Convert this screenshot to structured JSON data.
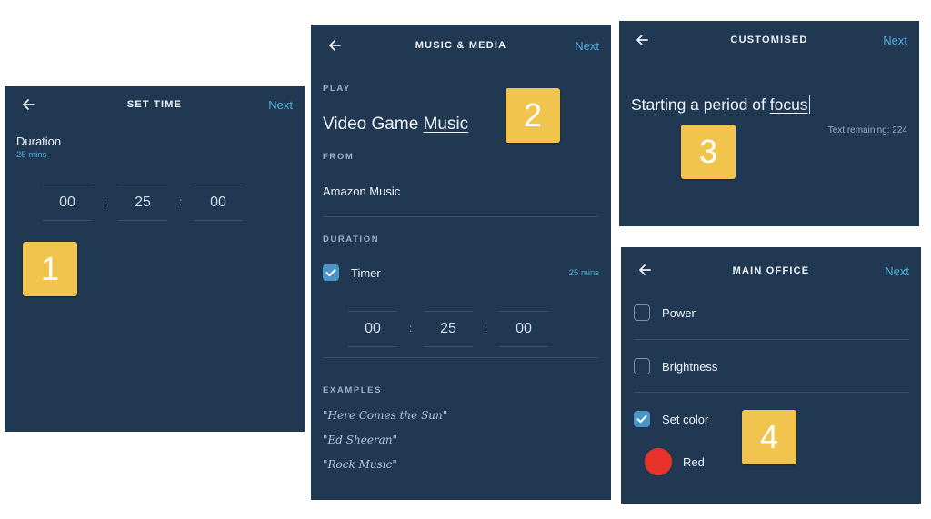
{
  "colors": {
    "panel_bg": "#213853",
    "accent": "#4fb0dc",
    "badge": "#f0c44d",
    "checkbox_on": "#4a95c8",
    "red_swatch": "#e8332a"
  },
  "panel1": {
    "badge": "1",
    "back_icon": "arrow-left-icon",
    "title": "SET TIME",
    "next": "Next",
    "duration_label": "Duration",
    "duration_value": "25 mins",
    "time": {
      "hours": "00",
      "minutes": "25",
      "seconds": "00",
      "separator": ":"
    }
  },
  "panel2": {
    "badge": "2",
    "back_icon": "arrow-left-icon",
    "title": "MUSIC & MEDIA",
    "next": "Next",
    "play_label": "PLAY",
    "play_prefix": "Video Game ",
    "play_keyword": "Music",
    "from_label": "FROM",
    "from_value": "Amazon Music",
    "duration_label": "DURATION",
    "timer_label": "Timer",
    "timer_checked": true,
    "timer_value": "25 mins",
    "time": {
      "hours": "00",
      "minutes": "25",
      "seconds": "00",
      "separator": ":"
    },
    "examples_label": "EXAMPLES",
    "examples": [
      "\"Here Comes the Sun\"",
      "\"Ed Sheeran\"",
      "\"Rock Music\""
    ]
  },
  "panel3": {
    "badge": "3",
    "back_icon": "arrow-left-icon",
    "title": "CUSTOMISED",
    "next": "Next",
    "text_prefix": "Starting a period of ",
    "text_keyword": "focus",
    "remaining": "Text remaining: 224"
  },
  "panel4": {
    "badge": "4",
    "back_icon": "arrow-left-icon",
    "title": "MAIN OFFICE",
    "next": "Next",
    "options": [
      {
        "label": "Power",
        "checked": false
      },
      {
        "label": "Brightness",
        "checked": false
      },
      {
        "label": "Set color",
        "checked": true
      }
    ],
    "color_name": "Red"
  }
}
